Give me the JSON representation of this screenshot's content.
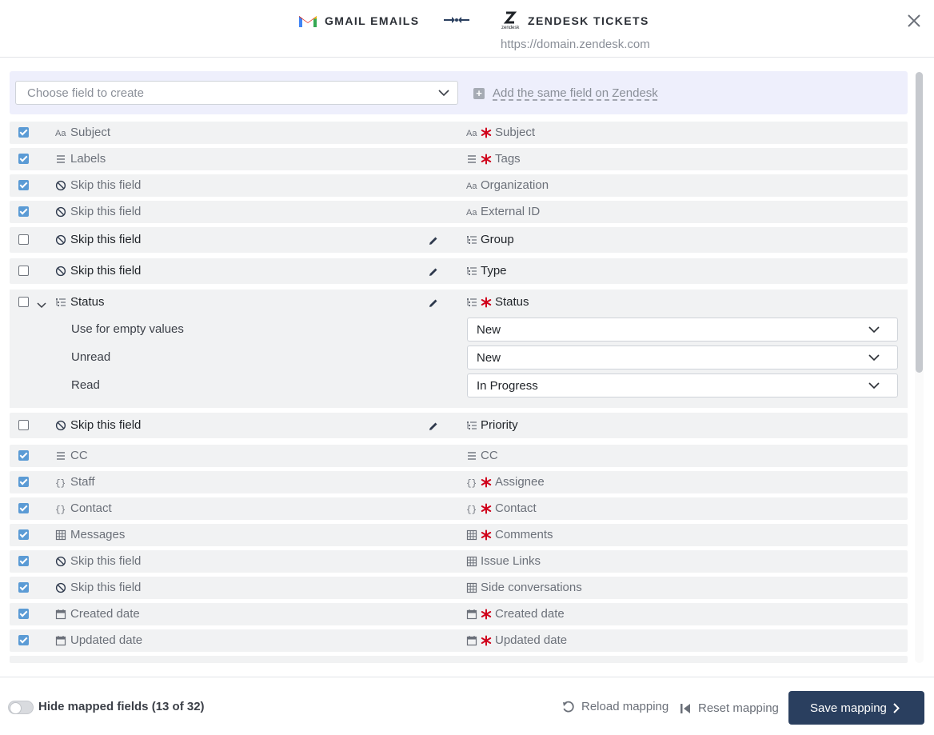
{
  "header": {
    "source_title": "GMAIL EMAILS",
    "source_icon": "gmail-logo",
    "target_title": "ZENDESK TICKETS",
    "target_icon": "zendesk-logo",
    "target_logo_caption": "zendesk",
    "target_url": "https://domain.zendesk.com",
    "close_icon": "close-icon"
  },
  "create_bar": {
    "placeholder": "Choose field to create",
    "add_same_label": "Add the same field on Zendesk"
  },
  "rows": [
    {
      "checked": true,
      "left_icon": "text-icon",
      "left": "Subject",
      "right_icon": "text-icon",
      "right": "Subject",
      "required": true
    },
    {
      "checked": true,
      "left_icon": "list-icon",
      "left": "Labels",
      "right_icon": "list-icon",
      "right": "Tags",
      "required": true
    },
    {
      "checked": true,
      "left_icon": "skip-icon",
      "left": "Skip this field",
      "right_icon": "text-icon",
      "right": "Organization",
      "required": false
    },
    {
      "checked": true,
      "left_icon": "skip-icon",
      "left": "Skip this field",
      "right_icon": "text-icon",
      "right": "External ID",
      "required": false
    },
    {
      "checked": false,
      "left_icon": "skip-icon",
      "left": "Skip this field",
      "right_icon": "select-list-icon",
      "right": "Group",
      "required": false,
      "editable": true
    },
    {
      "checked": false,
      "left_icon": "skip-icon",
      "left": "Skip this field",
      "right_icon": "select-list-icon",
      "right": "Type",
      "required": false,
      "editable": true
    },
    {
      "checked": false,
      "left_icon": "select-list-icon",
      "left": "Status",
      "right_icon": "select-list-icon",
      "right": "Status",
      "required": true,
      "editable": true,
      "expanded": true
    },
    {
      "checked": false,
      "left_icon": "skip-icon",
      "left": "Skip this field",
      "right_icon": "select-list-icon",
      "right": "Priority",
      "required": false,
      "editable": true
    },
    {
      "checked": true,
      "left_icon": "list-icon",
      "left": "CC",
      "right_icon": "list-icon",
      "right": "CC",
      "required": false
    },
    {
      "checked": true,
      "left_icon": "object-icon",
      "left": "Staff",
      "right_icon": "object-icon",
      "right": "Assignee",
      "required": true
    },
    {
      "checked": true,
      "left_icon": "object-icon",
      "left": "Contact",
      "right_icon": "object-icon",
      "right": "Contact",
      "required": true
    },
    {
      "checked": true,
      "left_icon": "table-icon",
      "left": "Messages",
      "right_icon": "table-icon",
      "right": "Comments",
      "required": true
    },
    {
      "checked": true,
      "left_icon": "skip-icon",
      "left": "Skip this field",
      "right_icon": "table-icon",
      "right": "Issue Links",
      "required": false
    },
    {
      "checked": true,
      "left_icon": "skip-icon",
      "left": "Skip this field",
      "right_icon": "table-icon",
      "right": "Side conversations",
      "required": false
    },
    {
      "checked": true,
      "left_icon": "calendar-icon",
      "left": "Created date",
      "right_icon": "calendar-icon",
      "right": "Created date",
      "required": true
    },
    {
      "checked": true,
      "left_icon": "calendar-icon",
      "left": "Updated date",
      "right_icon": "calendar-icon",
      "right": "Updated date",
      "required": true
    }
  ],
  "status_values": [
    {
      "label": "Use for empty values",
      "value": "New"
    },
    {
      "label": "Unread",
      "value": "New"
    },
    {
      "label": "Read",
      "value": "In Progress"
    }
  ],
  "footer": {
    "hide_mapped_label": "Hide mapped fields (13 of 32)",
    "hide_mapped_on": false,
    "reload_label": "Reload mapping",
    "reset_label": "Reset mapping",
    "save_label": "Save mapping"
  },
  "colors": {
    "accent": "#2a3f5f",
    "checkbox": "#5b9bd5",
    "required": "#d0021b",
    "create_bar_bg": "#eeeffc"
  }
}
